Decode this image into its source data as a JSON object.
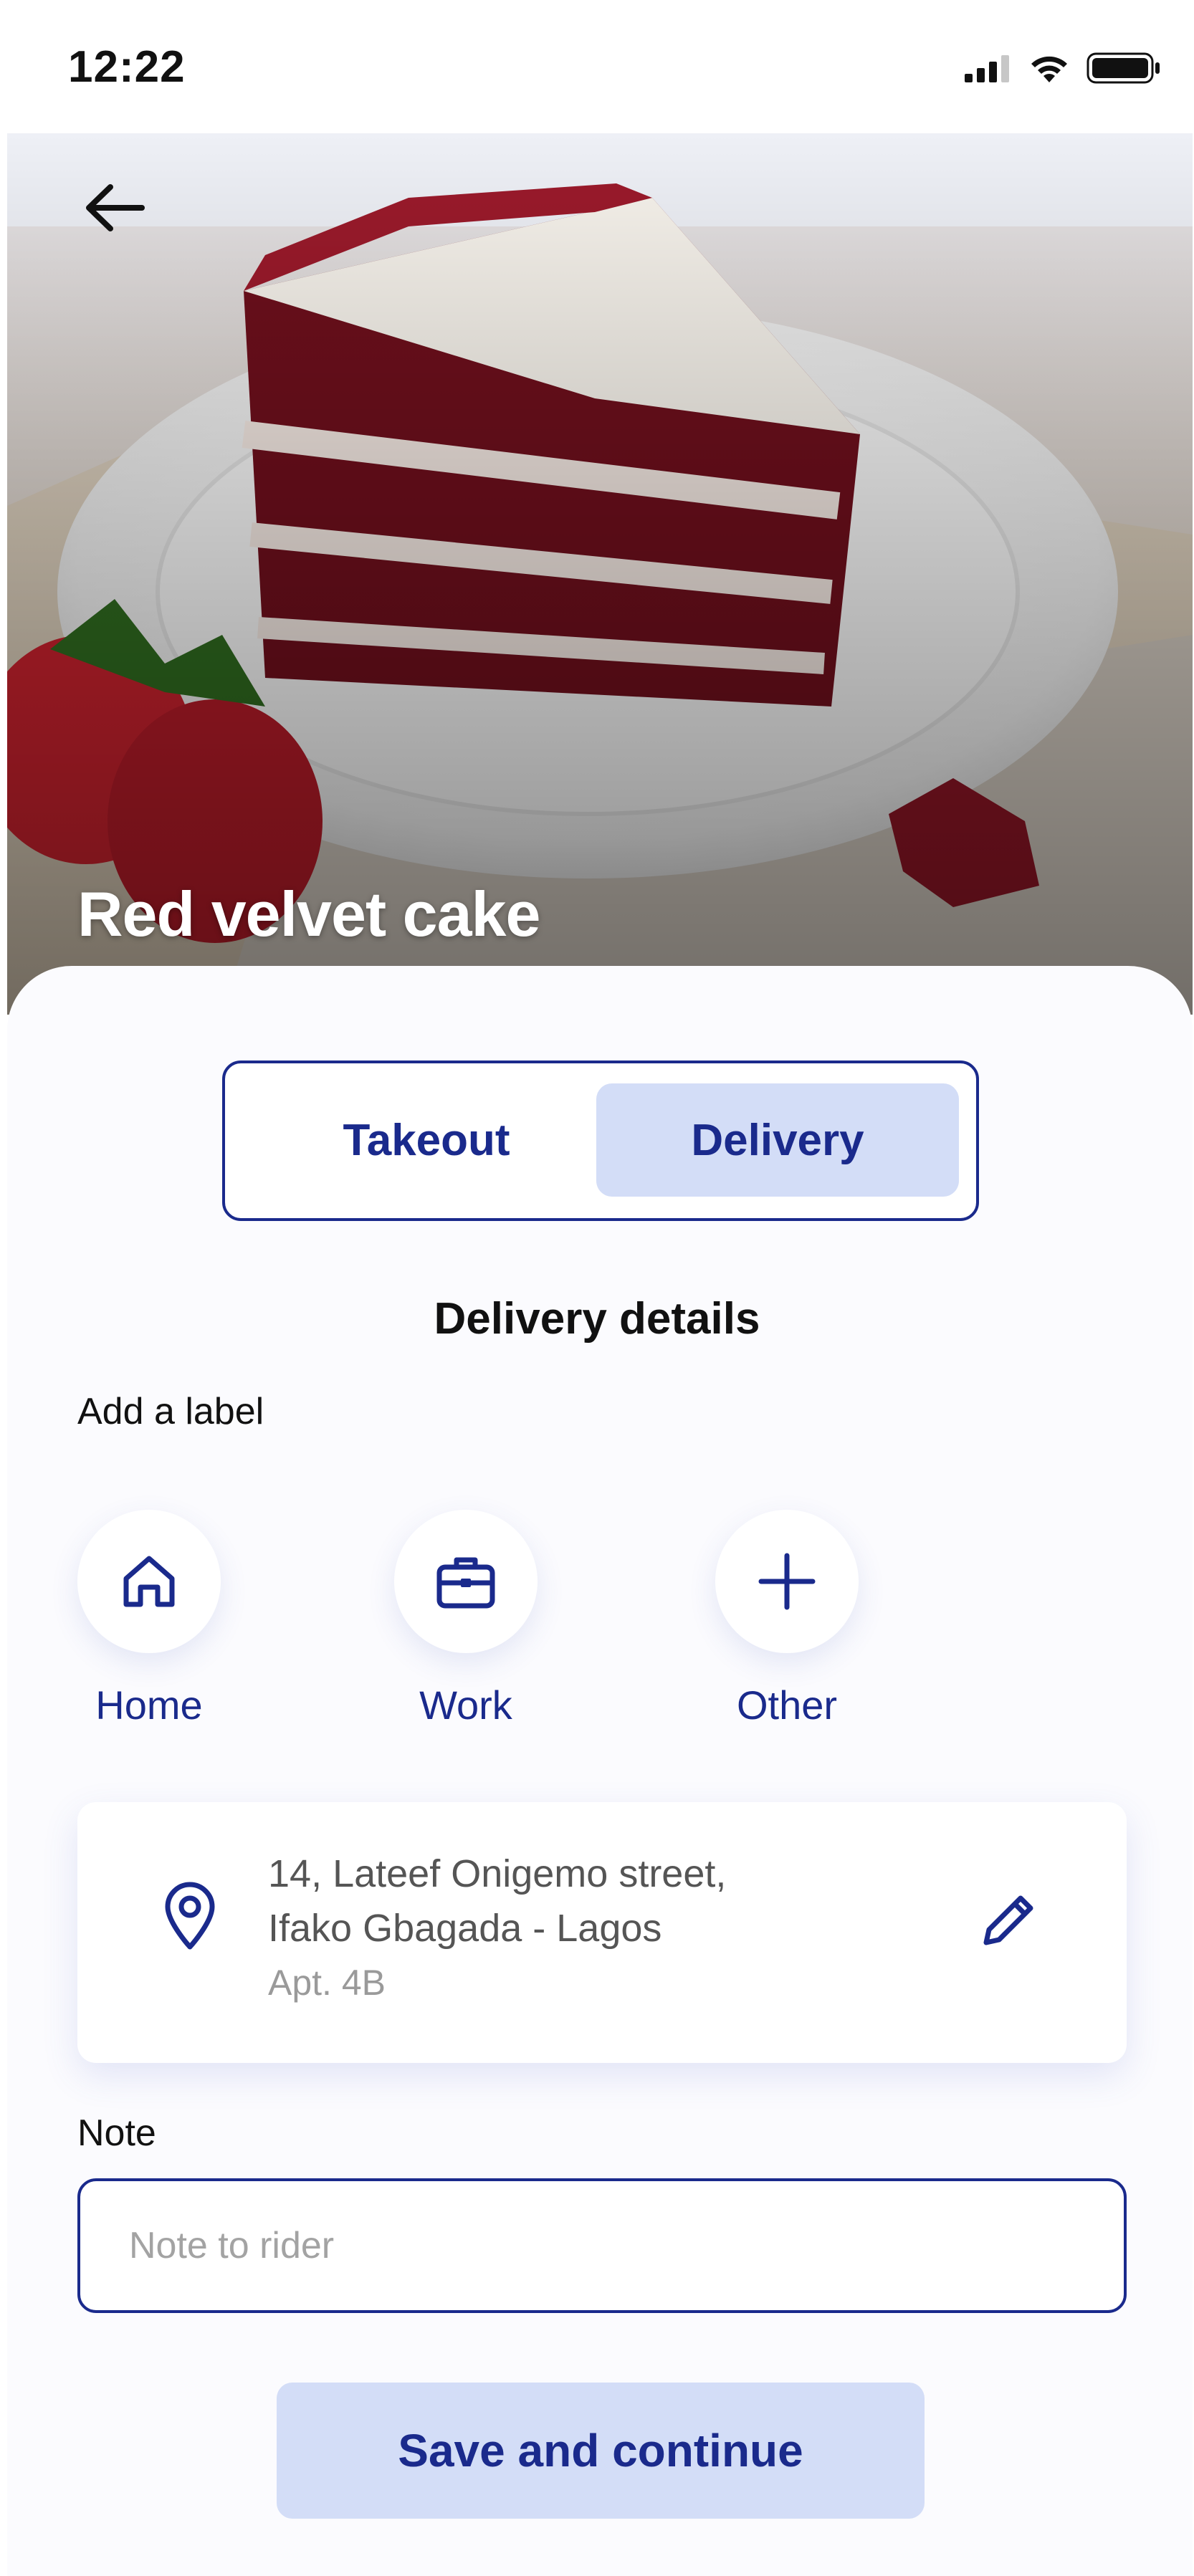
{
  "status_bar": {
    "time": "12:22"
  },
  "product": {
    "title": "Red velvet cake"
  },
  "order_mode": {
    "tabs": [
      {
        "label": "Takeout",
        "selected": false
      },
      {
        "label": "Delivery",
        "selected": true
      }
    ]
  },
  "delivery": {
    "title": "Delivery details",
    "add_label": "Add a label",
    "labels": [
      {
        "label": "Home",
        "icon": "home-icon"
      },
      {
        "label": "Work",
        "icon": "briefcase-icon"
      },
      {
        "label": "Other",
        "icon": "plus-icon"
      }
    ],
    "address": {
      "line1": "14, Lateef Onigemo street,",
      "line2": "Ifako Gbagada - Lagos",
      "line3": "Apt. 4B"
    },
    "note_label": "Note",
    "note_placeholder": "Note to rider",
    "note_value": ""
  },
  "actions": {
    "save_label": "Save and continue"
  },
  "colors": {
    "accent": "#1a2a8c",
    "accent_light": "#d3ddf7",
    "background": "#fbfbfe"
  }
}
